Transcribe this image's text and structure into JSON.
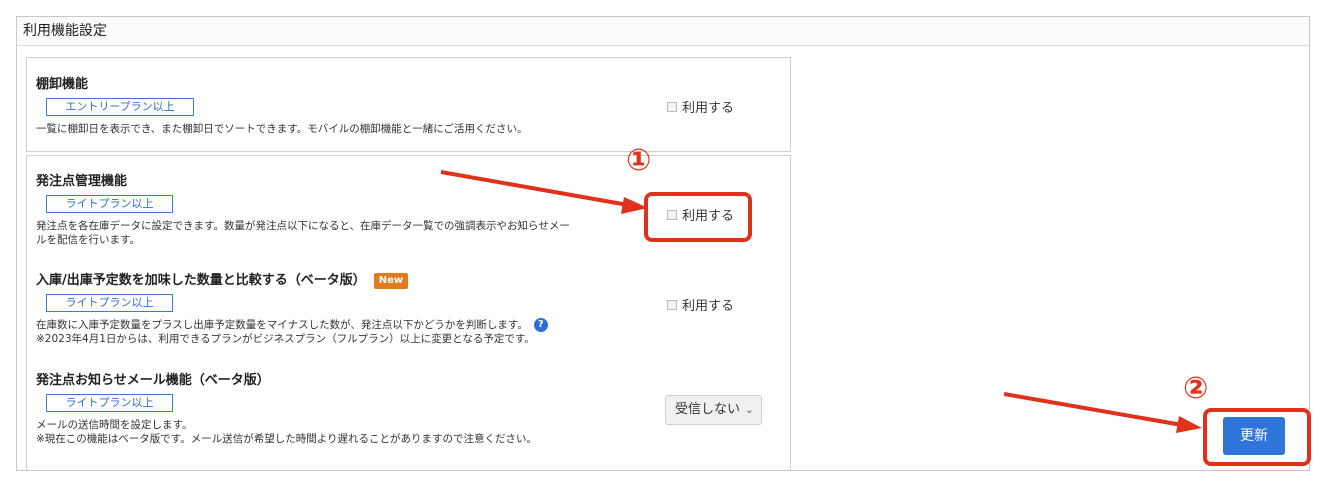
{
  "panel": {
    "title": "利用機能設定"
  },
  "inventory": {
    "title": "棚卸機能",
    "plan": "エントリープラン以上",
    "description": "一覧に棚卸日を表示でき、また棚卸日でソートできます。モバイルの棚卸機能と一緒にご活用ください。",
    "checkbox_label": "利用する"
  },
  "reorder": {
    "title": "発注点管理機能",
    "plan": "ライトプラン以上",
    "description_1": "発注点を各在庫データに設定できます。数量が発注点以下になると、在庫データ一覧での強調表示やお知らせメー",
    "description_2": "ルを配信を行います。",
    "checkbox_label": "利用する"
  },
  "compare": {
    "title": "入庫/出庫予定数を加味した数量と比較する（ベータ版）",
    "new_badge": "New",
    "plan": "ライトプラン以上",
    "description_1": "在庫数に入庫予定数量をプラスし出庫予定数量をマイナスした数が、発注点以下かどうかを判断します。",
    "description_2": "※2023年4月1日からは、利用できるプランがビジネスプラン（フルプラン）以上に変更となる予定です。",
    "help_icon": "?",
    "checkbox_label": "利用する"
  },
  "mail": {
    "title": "発注点お知らせメール機能（ベータ版）",
    "plan": "ライトプラン以上",
    "description_1": "メールの送信時間を設定します。",
    "description_2": "※現在この機能はベータ版です。メール送信が希望した時間より遅れることがありますので注意ください。",
    "select_value": "受信しない",
    "chevron": "⌄"
  },
  "update_button": {
    "label": "更新"
  },
  "annotations": {
    "marker_1": "①",
    "marker_2": "②",
    "color": "#e0311a"
  }
}
